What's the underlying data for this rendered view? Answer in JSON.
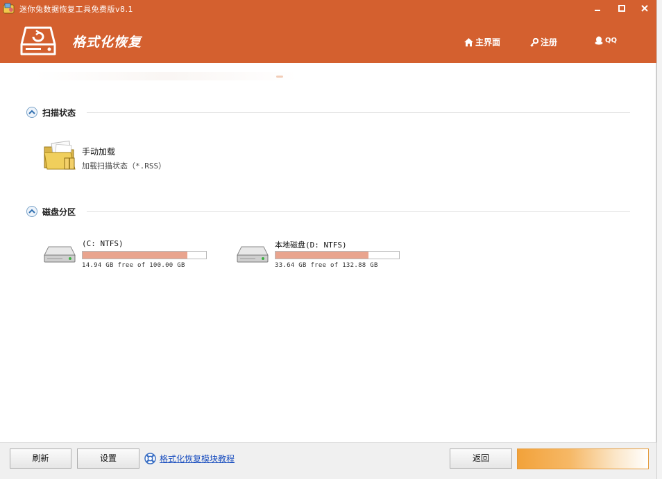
{
  "window": {
    "title": "迷你兔数据恢复工具免费版v8.1",
    "controls": {
      "minimize": "▬",
      "maximize": "▢",
      "close": "✕"
    }
  },
  "header": {
    "title": "格式化恢复",
    "nav": [
      {
        "label": "主界面",
        "icon": "home-icon"
      },
      {
        "label": "注册",
        "icon": "key-icon"
      },
      {
        "label": "QQ",
        "icon": "qq-penguin-icon"
      }
    ]
  },
  "scan_section": {
    "title": "扫描状态",
    "load_item": {
      "title": "手动加载",
      "subtitle": "加载扫描状态（*.RSS）"
    }
  },
  "partition_section": {
    "title": "磁盘分区",
    "drives": [
      {
        "name": "(C: NTFS)",
        "used_fraction": 0.85,
        "free_text": "14.94 GB free of 100.00 GB"
      },
      {
        "name": "本地磁盘(D: NTFS)",
        "used_fraction": 0.75,
        "free_text": "33.64 GB free of 132.88 GB"
      }
    ]
  },
  "footer": {
    "refresh_label": "刷新",
    "settings_label": "设置",
    "tutorial_link": "格式化恢复模块教程",
    "back_label": "返回",
    "next_label": ""
  },
  "colors": {
    "brand": "#d4602f",
    "usage_bar": "#e9a48e",
    "link": "#1b4fbf"
  }
}
